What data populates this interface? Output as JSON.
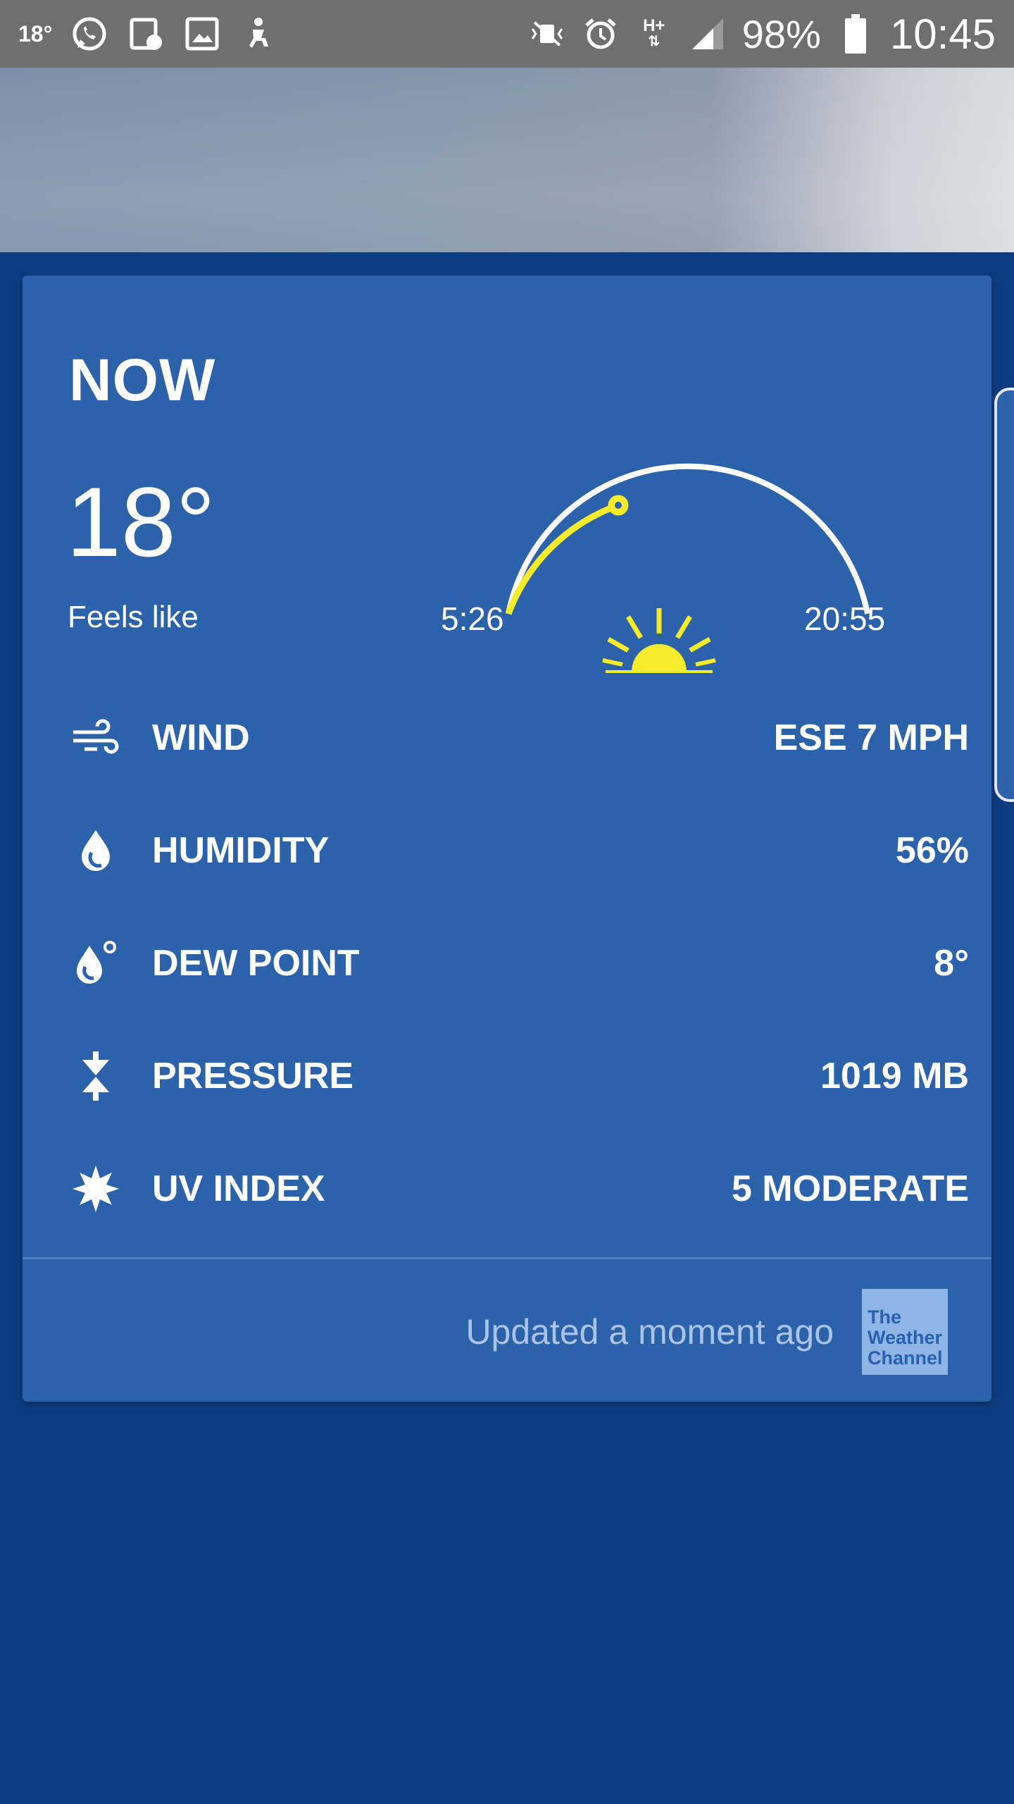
{
  "status_bar": {
    "temp": "18°",
    "battery": "98%",
    "time": "10:45",
    "network": "H+"
  },
  "card": {
    "title": "NOW",
    "temperature": "18°",
    "feels_like": "Feels like",
    "sunrise": "5:26",
    "sunset": "20:55",
    "rows": [
      {
        "icon": "wind-icon",
        "label": "WIND",
        "value": "ESE 7 MPH"
      },
      {
        "icon": "humidity-icon",
        "label": "HUMIDITY",
        "value": "56%"
      },
      {
        "icon": "dew-point-icon",
        "label": "DEW POINT",
        "value": "8°"
      },
      {
        "icon": "pressure-icon",
        "label": "PRESSURE",
        "value": "1019 MB"
      },
      {
        "icon": "uv-icon",
        "label": "UV INDEX",
        "value": "5 MODERATE"
      }
    ],
    "updated": "Updated a moment ago",
    "logo_text": "The Weather Channel"
  },
  "colors": {
    "background": "#0d3c80",
    "card": "#2c62aa",
    "sun": "#f5ea2b",
    "status_bar": "#6f6f6f"
  }
}
